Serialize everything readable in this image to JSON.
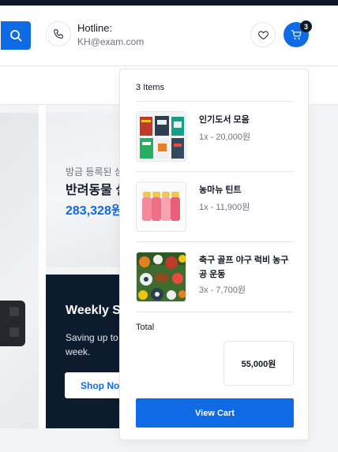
{
  "header": {
    "hotline_label": "Hotline:",
    "hotline_email": "KH@exam.com",
    "cart_count": "3"
  },
  "promo": {
    "top_subtitle": "방금 등록된 상",
    "top_title": "반려동물 실",
    "top_price": "283,328원",
    "bottom_title": "Weekly S",
    "bottom_text_line1": "Saving up to",
    "bottom_text_line2": "week.",
    "bottom_button": "Shop Now"
  },
  "cart": {
    "items_count_label": "3 Items",
    "items": [
      {
        "name": "인기도서 모음",
        "qty_price": "1x - 20,000원",
        "thumb": "book-collection"
      },
      {
        "name": "농마뉴 틴트",
        "qty_price": "1x - 11,900원",
        "thumb": "tint-bottles"
      },
      {
        "name": "축구 골프 야구 럭비 농구공 운동",
        "qty_price": "3x - 7,700원",
        "thumb": "sports-balls"
      }
    ],
    "total_label": "Total",
    "total_value": "55,000원",
    "view_cart_label": "View Cart"
  },
  "colors": {
    "accent": "#0f6ae6",
    "dark": "#0c1c2e"
  }
}
